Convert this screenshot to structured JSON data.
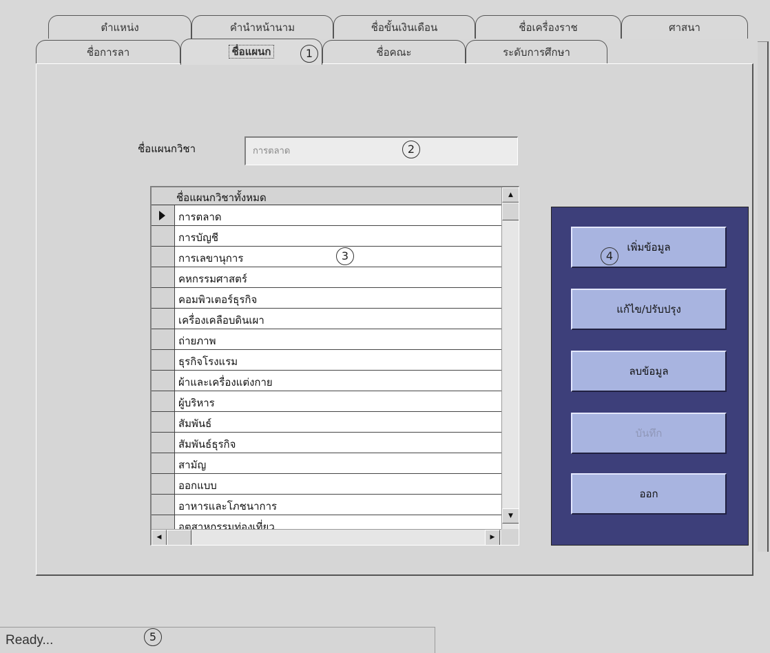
{
  "tabs_back_row": [
    "ตำแหน่ง",
    "คำนำหน้านาม",
    "ชื่อขั้นเงินเดือน",
    "ชื่อเครื่องราช",
    "ศาสนา"
  ],
  "tabs_front_row": [
    "ชื่อการลา",
    "ชื่อแผนก",
    "ชื่อคณะ",
    "ระดับการศึกษา"
  ],
  "form": {
    "department_label": "ชื่อแผนกวิชา",
    "department_value": "การตลาด"
  },
  "grid": {
    "header": "ชื่อแผนกวิชาทั้งหมด",
    "rows": [
      "การตลาด",
      "การบัญชี",
      "การเลขานุการ",
      "คหกรรมศาสตร์",
      "คอมพิวเตอร์ธุรกิจ",
      "เครื่องเคลือบดินเผา",
      "ถ่ายภาพ",
      "ธุรกิจโรงแรม",
      "ผ้าและเครื่องแต่งกาย",
      "ผู้บริหาร",
      "สัมพันธ์",
      "สัมพันธ์ธุรกิจ",
      "สามัญ",
      "ออกแบบ",
      "อาหารและโภชนาการ",
      "อุตสาหกรรมท่องเที่ยว"
    ]
  },
  "actions": {
    "add": "เพิ่มข้อมูล",
    "edit": "แก้ไข/ปรับปรุง",
    "delete": "ลบข้อมูล",
    "save": "บันทึก",
    "exit": "ออก"
  },
  "markers": [
    "1",
    "2",
    "3",
    "4",
    "5"
  ],
  "status": {
    "text": "Ready..."
  },
  "colors": {
    "button_panel": "#3d3f7a",
    "button_face": "#a8b4e0",
    "window_bg": "#d8d8d8"
  }
}
